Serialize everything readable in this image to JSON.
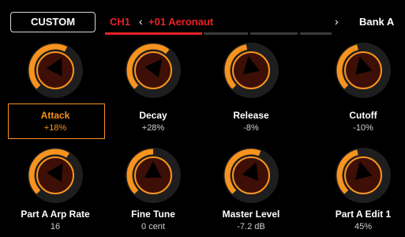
{
  "header": {
    "custom_label": "CUSTOM",
    "channel": "CH1",
    "patch": "+01 Aeronaut",
    "prev_icon": "chevron-left-icon",
    "next_icon": "chevron-right-icon",
    "bank": "Bank A"
  },
  "colors": {
    "accent_orange": "#f7931e",
    "channel_red": "#e8222a",
    "knob_body": "#3d0f06",
    "knob_track": "#1e1e1e"
  },
  "knobs": [
    {
      "label": "Attack",
      "value": "+18%",
      "level": 0.6,
      "selected": true
    },
    {
      "label": "Decay",
      "value": "+28%",
      "level": 0.64,
      "selected": false
    },
    {
      "label": "Release",
      "value": "-8%",
      "level": 0.46,
      "selected": false
    },
    {
      "label": "Cutoff",
      "value": "-10%",
      "level": 0.45,
      "selected": false
    },
    {
      "label": "Part A Arp Rate",
      "value": "16",
      "level": 0.62,
      "selected": false
    },
    {
      "label": "Fine Tune",
      "value": "0 cent",
      "level": 0.5,
      "selected": false
    },
    {
      "label": "Master Level",
      "value": "-7.2 dB",
      "level": 0.58,
      "selected": false
    },
    {
      "label": "Part A Edit 1",
      "value": "45%",
      "level": 0.45,
      "selected": false
    }
  ]
}
